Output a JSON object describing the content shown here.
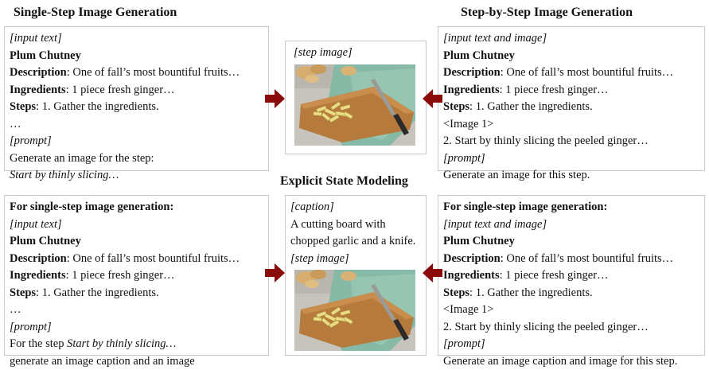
{
  "headings": {
    "single_step": "Single-Step Image Generation",
    "step_by_step": "Step-by-Step Image Generation",
    "explicit_state": "Explicit State Modeling"
  },
  "top_left": {
    "tag": "[input text]",
    "title": "Plum Chutney",
    "desc_label": "Description",
    "desc_text": ": One of fall’s most bountiful fruits…",
    "ing_label": "Ingredients",
    "ing_text": ": 1 piece fresh ginger…",
    "steps_label": "Steps",
    "steps_text": ": 1. Gather the ingredients.",
    "ellipsis": "…",
    "prompt_tag": "[prompt]",
    "prompt_line1": "Generate an image for the step:",
    "prompt_line2": "Start by thinly slicing…"
  },
  "top_mid": {
    "tag": "[step image]"
  },
  "top_right": {
    "tag": "[input text and image]",
    "title": "Plum Chutney",
    "desc_label": "Description",
    "desc_text": ": One of fall’s most bountiful fruits…",
    "ing_label": "Ingredients",
    "ing_text": ": 1 piece fresh ginger…",
    "steps_label": "Steps",
    "steps_text": ": 1. Gather the ingredients.",
    "image_ref": "<Image 1>",
    "step2": "2. Start by thinly slicing the peeled ginger…",
    "prompt_tag": "[prompt]",
    "prompt_line1": "Generate an image for this step."
  },
  "bot_left": {
    "header": "For single-step image generation:",
    "tag": "[input text]",
    "title": "Plum Chutney",
    "desc_label": "Description",
    "desc_text": ": One of fall’s most bountiful fruits…",
    "ing_label": "Ingredients",
    "ing_text": ": 1 piece fresh ginger…",
    "steps_label": "Steps",
    "steps_text": ": 1. Gather the ingredients.",
    "ellipsis": "…",
    "prompt_tag": "[prompt]",
    "prompt_pre": "For the step ",
    "prompt_italic": "Start by thinly slicing…",
    "prompt_line2": "generate an image caption and an image"
  },
  "bot_mid": {
    "caption_tag": "[caption]",
    "caption_line1": "A cutting board with",
    "caption_line2": "chopped garlic and a knife.",
    "image_tag": "[step image]"
  },
  "bot_right": {
    "header": "For single-step image generation:",
    "tag": "[input text and image]",
    "title": "Plum Chutney",
    "desc_label": "Description",
    "desc_text": ": One of fall’s most bountiful fruits…",
    "ing_label": "Ingredients",
    "ing_text": ": 1 piece fresh ginger…",
    "steps_label": "Steps",
    "steps_text": ": 1. Gather the ingredients.",
    "image_ref": "<Image 1>",
    "step2": "2. Start by thinly slicing the peeled ginger…",
    "prompt_tag": "[prompt]",
    "prompt_line1": "Generate an image caption and image for this step."
  },
  "colors": {
    "arrow": "#8b0a0a",
    "border": "#c8c8c8"
  }
}
